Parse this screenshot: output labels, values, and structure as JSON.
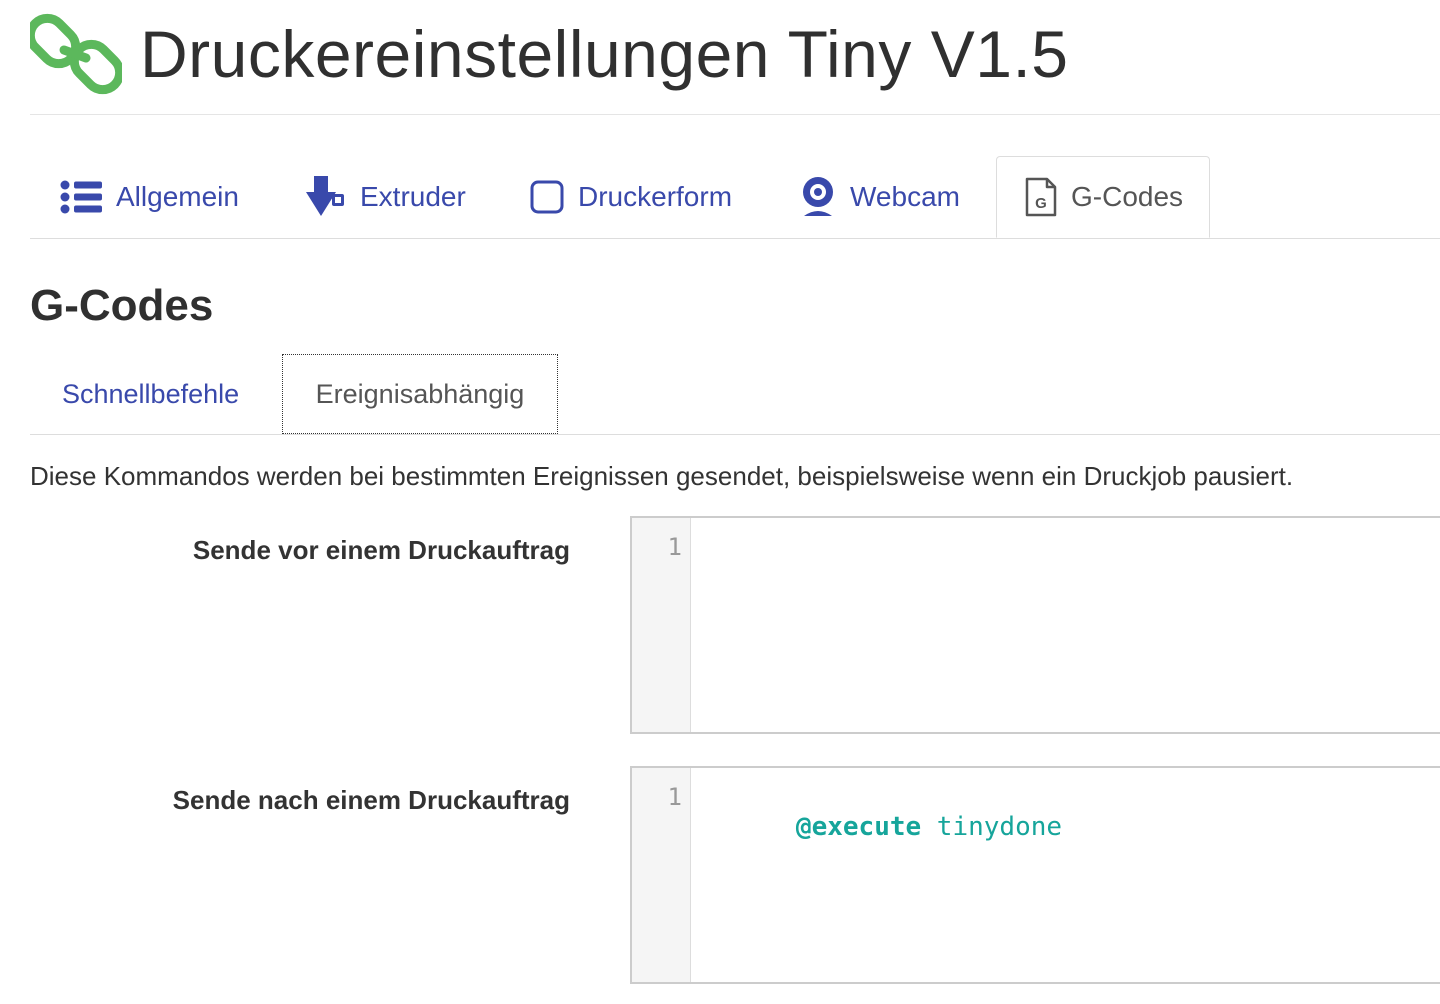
{
  "header": {
    "title": "Druckereinstellungen Tiny V1.5",
    "logo_icon": "link-chain-icon",
    "logo_color": "#5cb85c"
  },
  "main_tabs": [
    {
      "label": "Allgemein",
      "icon": "list-icon",
      "active": false
    },
    {
      "label": "Extruder",
      "icon": "extruder-icon",
      "active": false
    },
    {
      "label": "Druckerform",
      "icon": "square-outline-icon",
      "active": false
    },
    {
      "label": "Webcam",
      "icon": "webcam-icon",
      "active": false
    },
    {
      "label": "G-Codes",
      "icon": "gcode-file-icon",
      "active": true
    }
  ],
  "section": {
    "title": "G-Codes",
    "sub_tabs": [
      {
        "label": "Schnellbefehle",
        "active": false
      },
      {
        "label": "Ereignisabhängig",
        "active": true
      }
    ],
    "description": "Diese Kommandos werden bei bestimmten Ereignissen gesendet, beispielsweise wenn ein Druckjob pausiert."
  },
  "fields": [
    {
      "label": "Sende vor einem Druckauftrag",
      "line_numbers": [
        "1"
      ],
      "code_keyword": "",
      "code_rest": ""
    },
    {
      "label": "Sende nach einem Druckauftrag",
      "line_numbers": [
        "1"
      ],
      "code_keyword": "@execute",
      "code_rest": " tinydone"
    }
  ],
  "colors": {
    "link": "#3949ab",
    "code": "#16a59b",
    "text": "#333333"
  }
}
